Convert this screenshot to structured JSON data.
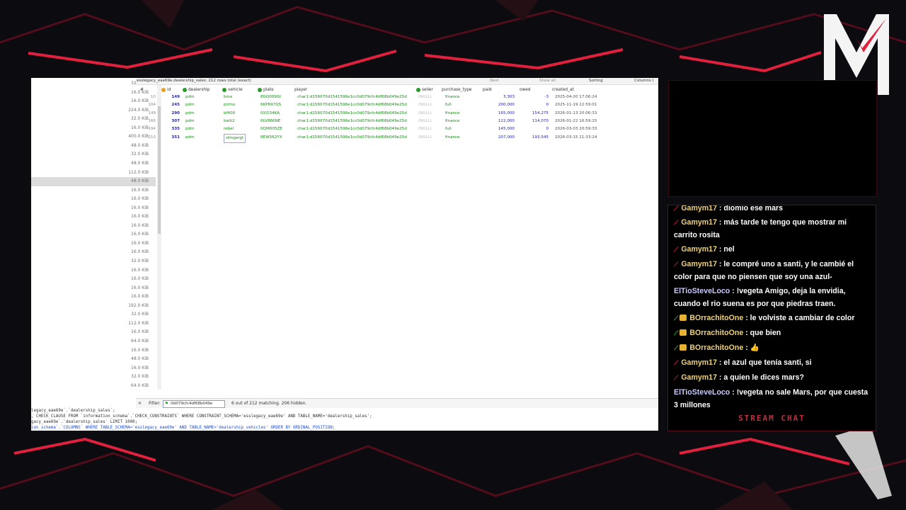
{
  "colors": {
    "accent": "#e0203c",
    "chat_user": "#f0d278",
    "chat_user_alt": "#c8c8ff",
    "text_green": "#1a8a1a",
    "number_blue": "#2020c0"
  },
  "logo": {
    "letter": "M"
  },
  "sizes": [
    "32.0 KiB",
    "16.0 KiB",
    "16.0 KiB",
    "224.0 KiB",
    "32.0 KiB",
    "16.0 KiB",
    "400.0 KiB",
    "48.0 KiB",
    "32.0 KiB",
    "48.0 KiB",
    "112.0 KiB",
    "48.0 KiB",
    "16.0 KiB",
    "16.0 KiB",
    "16.0 KiB",
    "16.0 KiB",
    "16.0 KiB",
    "16.0 KiB",
    "16.0 KiB",
    "16.0 KiB",
    "32.0 KiB",
    "16.0 KiB",
    "16.0 KiB",
    "16.0 KiB",
    "16.0 KiB",
    "192.0 KiB",
    "32.0 KiB",
    "112.0 KiB",
    "16.0 KiB",
    "64.0 KiB",
    "16.0 KiB",
    "48.0 KiB",
    "16.0 KiB",
    "32.0 KiB",
    "64.0 KiB"
  ],
  "grid": {
    "title": "esslegacy_eae69e.dealership_sales: 212 rows total (exact)",
    "toolbar": {
      "next": "Next",
      "show_all": "Show all",
      "sorting": "Sorting",
      "columns": "Columns ("
    },
    "columns": [
      "#",
      "id",
      "dealership",
      "vehicle",
      "plate",
      "player",
      "seller",
      "purchase_type",
      "paid",
      "owed",
      "created_at"
    ],
    "rows": [
      [
        "10",
        "149",
        "pdm",
        "bmx",
        "8GQ009GI",
        "char1:d156070d1541596e1cc0d079cfc4df68b049e25d",
        "(NULL)",
        "finance",
        "3,303",
        "-3",
        "2025-04-20 17:06:24"
      ],
      [
        "104",
        "245",
        "pdm",
        "primo",
        "6KP697QS",
        "char1:d156070d1541596e1cc0d079cfc4df68b049e25d",
        "(NULL)",
        "full",
        "200,000",
        "0",
        "2025-11-19 22:59:01"
      ],
      [
        "149",
        "290",
        "pdm",
        "bf400",
        "0XI154KA",
        "char1:d156070d1541596e1cc0d079cfc4df68b049e25d",
        "(NULL)",
        "finance",
        "165,000",
        "154,275",
        "2026-01-13 20:06:33"
      ],
      [
        "166",
        "307",
        "pdm",
        "baiti2",
        "6LV866NE",
        "char1:d156070d1541596e1cc0d079cfc4df68b049e25d",
        "(NULL)",
        "finance",
        "122,000",
        "114,070",
        "2026-01-22 16:59:15"
      ],
      [
        "194",
        "335",
        "pdm",
        "rebel",
        "0QM005ZE",
        "char1:d156070d1541596e1cc0d079cfc4df68b049e25d",
        "(NULL)",
        "full",
        "145,000",
        "0",
        "2026-03-03 20:59:33"
      ],
      [
        "210",
        "351",
        "pdm",
        "stingergt",
        "8EW562YX",
        "char1:d156070d1541596e1cc0d079cfc4df68b049e25d",
        "(NULL)",
        "finance",
        "207,000",
        "193,545",
        "2026-03-15 21:33:24"
      ]
    ]
  },
  "filter": {
    "label": "Filter:",
    "value": ":0d079cfc4df68b049e",
    "status": "6 out of 212 matching. 206 hidden."
  },
  "sql": [
    "legacy_eae69e`.`dealership_sales`;",
    ", CHECK_CLAUSE FROM `information_schema`.`CHECK_CONSTRAINTS` WHERE CONSTRAINT_SCHEMA='esslegacy_eae69e' AND TABLE_NAME='dealership_sales';",
    "gacy_eae69e`.`dealership_sales` LIMIT 1000;",
    "ion_schema`.`COLUMNS` WHERE TABLE_SCHEMA='esslegacy_eae69e' AND TABLE_NAME='dealership_vehicles' ORDER BY ORDINAL_POSITION;"
  ],
  "chat": {
    "title": "STREAM CHAT",
    "messages": [
      {
        "user": "Gamym17",
        "text": "diomio ese mars",
        "style": "red"
      },
      {
        "user": "Gamym17",
        "text": "más tarde te tengo que mostrar mi carrito rosita",
        "style": "red"
      },
      {
        "user": "Gamym17",
        "text": "nel",
        "style": "red"
      },
      {
        "user": "Gamym17",
        "text": "le compré uno a santi, y le cambié el color para que no piensen que soy una azul-",
        "style": "red"
      },
      {
        "user": "ElTioSteveLoco",
        "text": "!vegeta Amigo, deja la envidia, cuando el rio suena es por que piedras traen.",
        "style": "plain"
      },
      {
        "user": "BOrrachitoOne",
        "text": "le volviste a cambiar de color",
        "style": "green"
      },
      {
        "user": "BOrrachitoOne",
        "text": "que bien",
        "style": "green"
      },
      {
        "user": "BOrrachitoOne",
        "text": "👍",
        "style": "green"
      },
      {
        "user": "Gamym17",
        "text": "el azul que tenía santi, si",
        "style": "red"
      },
      {
        "user": "Gamym17",
        "text": "a quien le dices mars?",
        "style": "red"
      },
      {
        "user": "ElTioSteveLoco",
        "text": "!vegeta no sale Mars, por que cuesta 3 millones",
        "style": "plain"
      }
    ]
  }
}
